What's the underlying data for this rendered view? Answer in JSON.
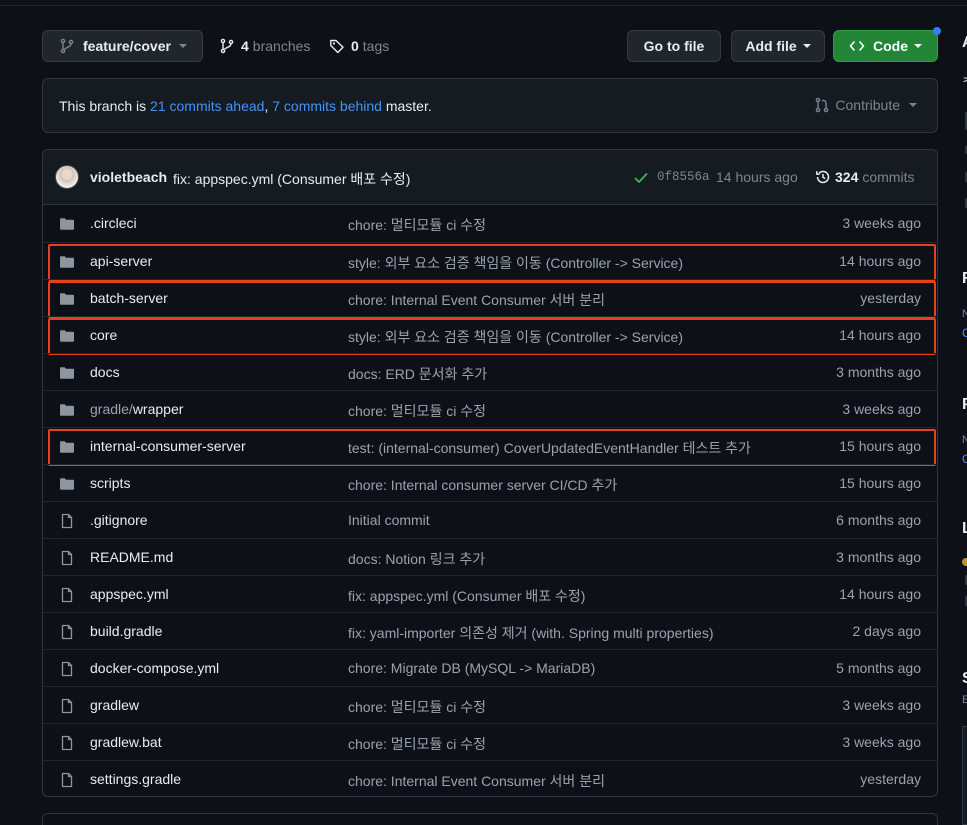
{
  "branch": {
    "name": "feature/cover",
    "branches_count": "4",
    "branches_label": "branches",
    "tags_count": "0",
    "tags_label": "tags"
  },
  "toolbar": {
    "goto_file": "Go to file",
    "add_file": "Add file",
    "code": "Code"
  },
  "colors": {
    "accent_green": "#238636",
    "link_blue": "#4493f8",
    "highlight_red": "#e8401c",
    "background": "#0d1117"
  },
  "ahead": {
    "prefix": "This branch is ",
    "ahead_link": "21 commits ahead",
    "sep": ", ",
    "behind_link": "7 commits behind",
    "suffix": " master.",
    "contribute": "Contribute"
  },
  "latest_commit": {
    "author": "violetbeach",
    "message": "fix: appspec.yml (Consumer 배포 수정)",
    "sha": "0f8556a",
    "time": "14 hours ago",
    "commits_count": "324",
    "commits_label": "commits"
  },
  "files": [
    {
      "type": "folder",
      "name": ".circleci",
      "message": "chore: 멀티모듈 ci 수정",
      "time": "3 weeks ago",
      "highlighted": false
    },
    {
      "type": "folder",
      "name": "api-server",
      "message": "style: 외부 요소 검증 책임을 이동 (Controller -> Service)",
      "time": "14 hours ago",
      "highlighted": true
    },
    {
      "type": "folder",
      "name": "batch-server",
      "message": "chore: Internal Event Consumer 서버 분리",
      "time": "yesterday",
      "highlighted": true
    },
    {
      "type": "folder",
      "name": "core",
      "message": "style: 외부 요소 검증 책임을 이동 (Controller -> Service)",
      "time": "14 hours ago",
      "highlighted": true
    },
    {
      "type": "folder",
      "name": "docs",
      "message": "docs: ERD 문서화 추가",
      "time": "3 months ago",
      "highlighted": false
    },
    {
      "type": "folder",
      "name": "gradle/wrapper",
      "name_dim": "gradle/",
      "name_main": "wrapper",
      "message": "chore: 멀티모듈 ci 수정",
      "time": "3 weeks ago",
      "highlighted": false
    },
    {
      "type": "folder",
      "name": "internal-consumer-server",
      "message": "test: (internal-consumer) CoverUpdatedEventHandler 테스트 추가",
      "time": "15 hours ago",
      "highlighted": true
    },
    {
      "type": "folder",
      "name": "scripts",
      "message": "chore: Internal consumer server CI/CD 추가",
      "time": "15 hours ago",
      "highlighted": false
    },
    {
      "type": "file",
      "name": ".gitignore",
      "message": "Initial commit",
      "time": "6 months ago",
      "highlighted": false
    },
    {
      "type": "file",
      "name": "README.md",
      "message": "docs: Notion 링크 추가",
      "time": "3 months ago",
      "highlighted": false
    },
    {
      "type": "file",
      "name": "appspec.yml",
      "message": "fix: appspec.yml (Consumer 배포 수정)",
      "time": "14 hours ago",
      "highlighted": false
    },
    {
      "type": "file",
      "name": "build.gradle",
      "message": "fix: yaml-importer 의존성 제거 (with. Spring multi properties)",
      "time": "2 days ago",
      "highlighted": false
    },
    {
      "type": "file",
      "name": "docker-compose.yml",
      "message": "chore: Migrate DB (MySQL -> MariaDB)",
      "time": "5 months ago",
      "highlighted": false
    },
    {
      "type": "file",
      "name": "gradlew",
      "message": "chore: 멀티모듈 ci 수정",
      "time": "3 weeks ago",
      "highlighted": false
    },
    {
      "type": "file",
      "name": "gradlew.bat",
      "message": "chore: 멀티모듈 ci 수정",
      "time": "3 weeks ago",
      "highlighted": false
    },
    {
      "type": "file",
      "name": "settings.gradle",
      "message": "chore: Internal Event Consumer 서버 분리",
      "time": "yesterday",
      "highlighted": false
    }
  ],
  "sidebar_partial": {
    "h1": "A",
    "t1": "ᄎ",
    "h2": "R",
    "h3": "P",
    "h4": "L",
    "h5": "S",
    "small_n": "N",
    "small_c": "C",
    "small_e": "E"
  }
}
